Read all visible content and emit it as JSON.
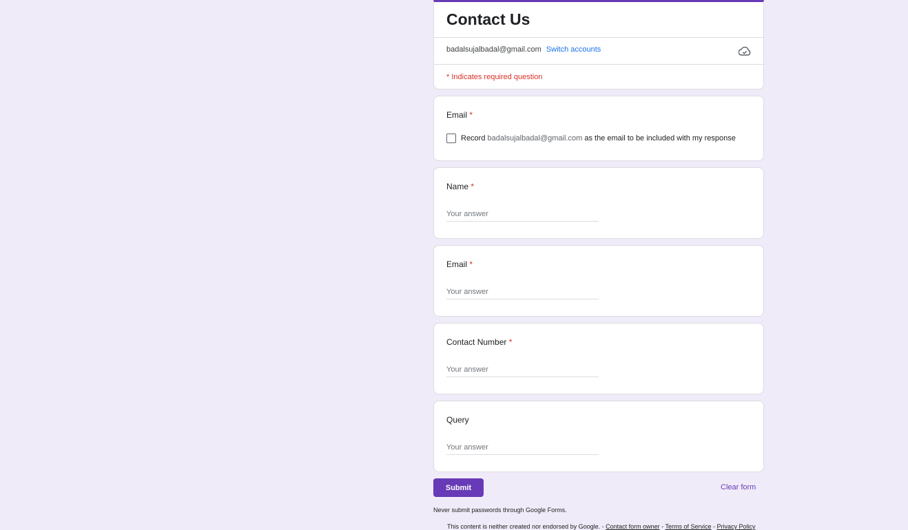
{
  "form": {
    "title": "Contact Us",
    "account_email": "badalsujalbadal@gmail.com",
    "switch_accounts": "Switch accounts",
    "required_note": "* Indicates required question",
    "cloud_icon": "cloud-icon"
  },
  "questions": {
    "email_record": {
      "label": "Email",
      "star": "*",
      "record_prefix": "Record",
      "record_email": "badalsujalbadal@gmail.com",
      "record_suffix": "as the email to be included with my response"
    },
    "name": {
      "label": "Name",
      "star": "*",
      "placeholder": "Your answer"
    },
    "email": {
      "label": "Email",
      "star": "*",
      "placeholder": "Your answer"
    },
    "contact": {
      "label": "Contact Number",
      "star": "*",
      "placeholder": "Your answer"
    },
    "query": {
      "label": "Query",
      "placeholder": "Your answer"
    }
  },
  "actions": {
    "submit": "Submit",
    "clear": "Clear form"
  },
  "footer": {
    "never_submit": "Never submit passwords through Google Forms.",
    "disclaimer": "This content is neither created nor endorsed by Google.",
    "sep1": " - ",
    "contact_owner": "Contact form owner",
    "sep2": " - ",
    "terms": "Terms of Service",
    "sep3": " - ",
    "privacy": "Privacy Policy"
  },
  "colors": {
    "accent": "#673ab7",
    "background": "#f0ebf8",
    "required": "#d93025",
    "link": "#1a73e8"
  }
}
